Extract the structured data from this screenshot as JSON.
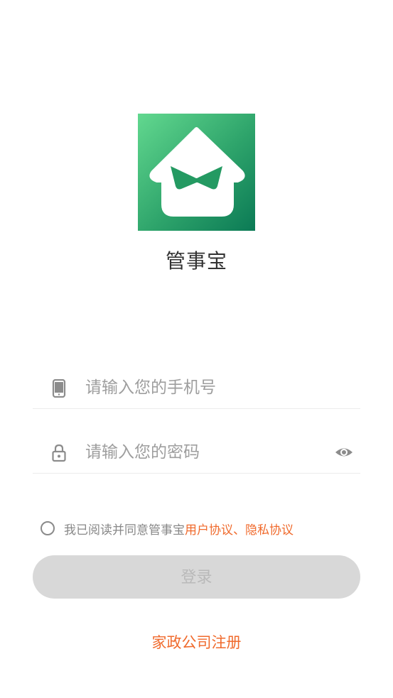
{
  "app": {
    "name": "管事宝",
    "logo_icon": "house-bowtie-logo-icon",
    "brand_gradient": [
      "#62d88f",
      "#0b7a55"
    ]
  },
  "phone_field": {
    "icon": "smartphone-icon",
    "placeholder": "请输入您的手机号",
    "value": ""
  },
  "password_field": {
    "icon": "lock-icon",
    "placeholder": "请输入您的密码",
    "value": "",
    "toggle_icon": "eye-icon"
  },
  "agreement": {
    "checked": false,
    "text": "我已阅读并同意管事宝",
    "user_agreement": "用户协议",
    "separator": "、",
    "privacy_agreement": "隐私协议",
    "link_color": "#f06a2c"
  },
  "login_button": {
    "label": "登录",
    "enabled": false
  },
  "register_link": {
    "label": "家政公司注册"
  }
}
